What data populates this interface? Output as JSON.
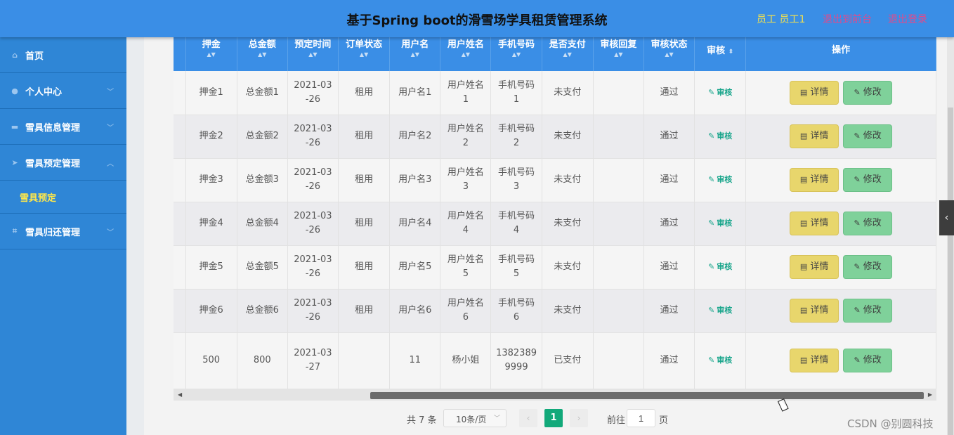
{
  "header": {
    "title": "基于Spring boot的滑雪场学具租赁管理系统",
    "user": "员工 员工1",
    "back_front": "退出到前台",
    "logout": "退出登录"
  },
  "sidebar": {
    "items": [
      {
        "label": "首页",
        "icon": "home-icon"
      },
      {
        "label": "个人中心",
        "icon": "user-icon"
      },
      {
        "label": "雪具信息管理",
        "icon": "briefcase-icon"
      },
      {
        "label": "雪具预定管理",
        "icon": "send-icon"
      },
      {
        "label": "雪具归还管理",
        "icon": "crop-icon"
      }
    ],
    "subitem": "雪具预定"
  },
  "table": {
    "columns": [
      "押金",
      "总金额",
      "预定时间",
      "订单状态",
      "用户名",
      "用户姓名",
      "手机号码",
      "是否支付",
      "审核回复",
      "审核状态",
      "审核",
      "操作"
    ],
    "rows": [
      [
        "押金1",
        "总金额1",
        "2021-03\n-26",
        "租用",
        "用户名1",
        "用户姓名\n1",
        "手机号码\n1",
        "未支付",
        "",
        "通过"
      ],
      [
        "押金2",
        "总金额2",
        "2021-03\n-26",
        "租用",
        "用户名2",
        "用户姓名\n2",
        "手机号码\n2",
        "未支付",
        "",
        "通过"
      ],
      [
        "押金3",
        "总金额3",
        "2021-03\n-26",
        "租用",
        "用户名3",
        "用户姓名\n3",
        "手机号码\n3",
        "未支付",
        "",
        "通过"
      ],
      [
        "押金4",
        "总金额4",
        "2021-03\n-26",
        "租用",
        "用户名4",
        "用户姓名\n4",
        "手机号码\n4",
        "未支付",
        "",
        "通过"
      ],
      [
        "押金5",
        "总金额5",
        "2021-03\n-26",
        "租用",
        "用户名5",
        "用户姓名\n5",
        "手机号码\n5",
        "未支付",
        "",
        "通过"
      ],
      [
        "押金6",
        "总金额6",
        "2021-03\n-26",
        "租用",
        "用户名6",
        "用户姓名\n6",
        "手机号码\n6",
        "未支付",
        "",
        "通过"
      ],
      [
        "500",
        "800",
        "2021-03\n-27",
        "",
        "11",
        "杨小姐",
        "1382389\n9999",
        "已支付",
        "",
        "通过"
      ]
    ],
    "audit_label": "审核",
    "detail_label": "详情",
    "edit_label": "修改"
  },
  "pager": {
    "total": "共 7 条",
    "page_size": "10条/页",
    "current": "1",
    "goto": "前往",
    "goto_value": "1",
    "page_word": "页"
  },
  "watermark": "CSDN @别圆科技",
  "colors": {
    "header": "#3a8ee6",
    "sidebar": "#2f86d6",
    "active_page": "#12a97a",
    "detail_button": "#e8d66c",
    "edit_button": "#7fd19a"
  }
}
